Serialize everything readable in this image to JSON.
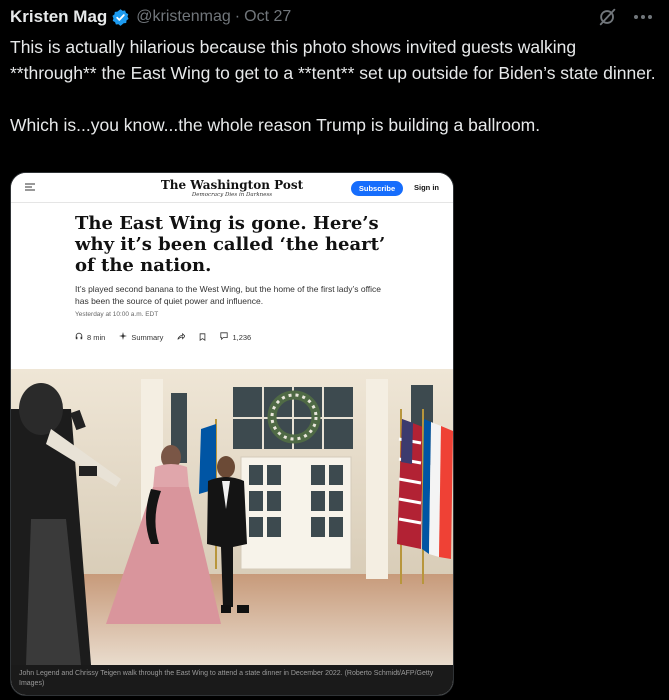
{
  "tweet": {
    "author_name": "Kristen Mag",
    "handle": "@kristenmag",
    "separator": "·",
    "date": "Oct 27",
    "text": "This is actually hilarious because this photo shows invited guests walking **through** the East Wing to get to a **tent** set up outside for Biden’s state dinner.\n\nWhich is...you know...the whole reason Trump is building a ballroom.",
    "icons": [
      "verified-badge-icon",
      "grok-icon",
      "more-icon"
    ],
    "colors": {
      "verified": "#1d9bf0",
      "muted": "#71767b",
      "text": "#e7e9ea",
      "background": "#000000"
    }
  },
  "article": {
    "masthead": "The Washington Post",
    "tagline": "Democracy Dies in Darkness",
    "subscribe_label": "Subscribe",
    "signin_label": "Sign in",
    "headline": "The East Wing is gone. Here’s why it’s been called ‘the heart’ of the nation.",
    "dek": "It’s played second banana to the West Wing, but the home of the first lady’s office has been the source of quiet power and influence.",
    "timestamp": "Yesterday at 10:00 a.m. EDT",
    "read_time": "8 min",
    "summary_label": "Summary",
    "comment_count": "1,236",
    "caption": "John Legend and Chrissy Teigen walk through the East Wing to attend a state dinner in December 2022. (Roberto Schmidt/AFP/Getty Images)",
    "colors": {
      "subscribe": "#166dfc"
    }
  }
}
